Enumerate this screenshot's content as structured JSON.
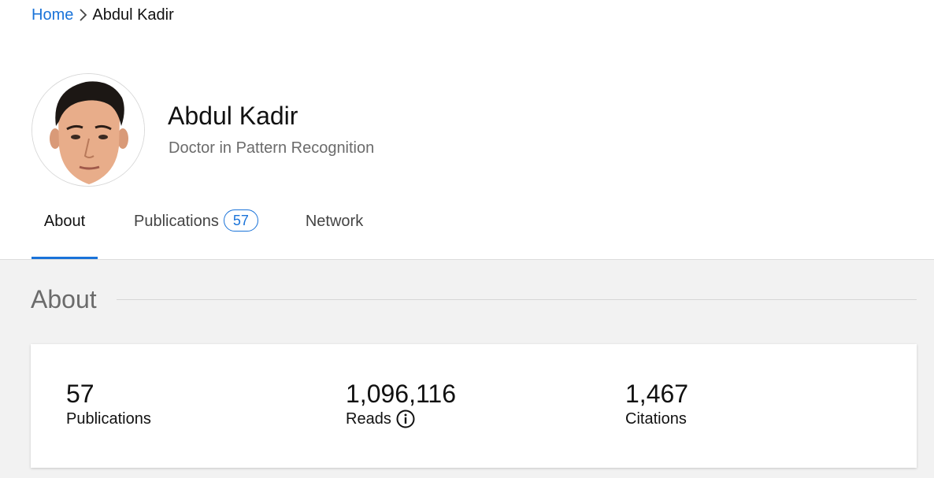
{
  "breadcrumb": {
    "home_label": "Home",
    "separator_icon": "chevron-right-icon",
    "current_label": "Abdul Kadir"
  },
  "profile": {
    "name": "Abdul Kadir",
    "role": "Doctor in Pattern Recognition"
  },
  "tabs": [
    {
      "label": "About",
      "active": true
    },
    {
      "label": "Publications",
      "count": "57"
    },
    {
      "label": "Network"
    }
  ],
  "about": {
    "heading": "About",
    "stats": [
      {
        "value": "57",
        "label": "Publications"
      },
      {
        "value": "1,096,116",
        "label": "Reads",
        "icon": "info-icon"
      },
      {
        "value": "1,467",
        "label": "Citations"
      }
    ]
  },
  "colors": {
    "accent": "#1a73d9",
    "background_gray": "#f2f2f2",
    "muted_text": "#6b6b6b"
  }
}
